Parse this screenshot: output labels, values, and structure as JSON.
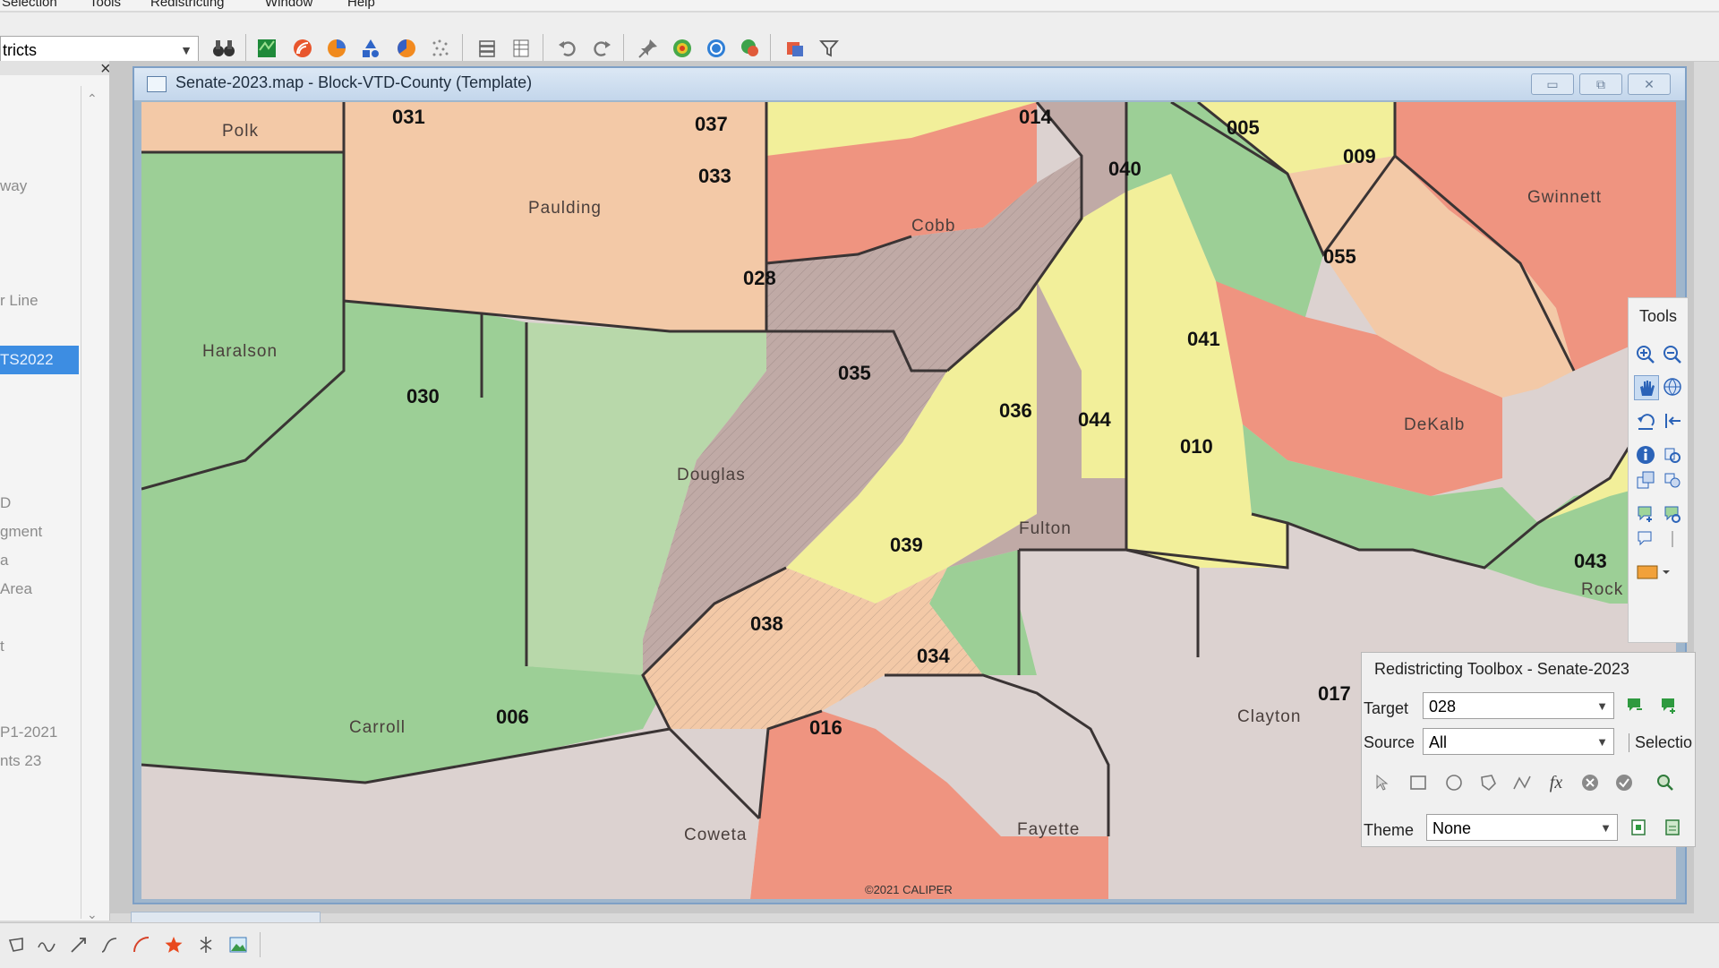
{
  "menu": {
    "items": [
      "Selection",
      "Tools",
      "Redistricting",
      "Window",
      "Help"
    ]
  },
  "toolbar": {
    "layer_select": "tricts",
    "icons": [
      "binoculars-icon",
      "map-layer-icon",
      "rss-layer-icon",
      "pie-chart-icon",
      "shapes-icon",
      "color-theme-icon",
      "dot-density-icon",
      "stack-icon",
      "table-icon",
      "undo-icon",
      "redo-icon",
      "pin-icon",
      "target-icon",
      "circle-icon",
      "map-search-icon",
      "map-overlay-icon",
      "filter-icon"
    ]
  },
  "left_panel": {
    "items": [
      "way",
      "r Line",
      "TS2022",
      "D",
      "gment",
      "a",
      " Area",
      "t",
      "P1-2021",
      "nts 23"
    ],
    "selected_index": 2
  },
  "map_window": {
    "title": "Senate-2023.map - Block-VTD-County (Template)",
    "buttons": [
      "▭",
      "⧉",
      "✕"
    ]
  },
  "map": {
    "district_labels": [
      "031",
      "037",
      "014",
      "005",
      "009",
      "033",
      "040",
      "028",
      "055",
      "041",
      "035",
      "036",
      "044",
      "010",
      "030",
      "039",
      "043",
      "038",
      "034",
      "006",
      "016",
      "017"
    ],
    "county_labels": [
      "Polk",
      "Paulding",
      "Cobb",
      "Gwinnett",
      "Haralson",
      "DeKalb",
      "Douglas",
      "Fulton",
      "Carroll",
      "Clayton",
      "Coweta",
      "Fayette",
      "Rock"
    ],
    "copyright": "©2021 CALIPER",
    "colors": {
      "peach": "#f3c9a7",
      "green": "#9ccf96",
      "light_green": "#b8d8aa",
      "yellow": "#f2ef9a",
      "salmon": "#ef9480",
      "mauve": "#c0aaa6",
      "light_gray": "#dcd2d0",
      "boundary": "#3a3434"
    }
  },
  "tools_panel": {
    "title": "Tools",
    "icons": [
      "zoom-in-icon",
      "zoom-out-icon",
      "pan-hand-icon",
      "globe-icon",
      "back-icon",
      "extent-icon",
      "info-icon",
      "label-icon",
      "layers-icon",
      "link-icon",
      "select-add-icon",
      "select-point-icon",
      "select-box-icon",
      "divider-icon",
      "palette-icon"
    ]
  },
  "toolbox": {
    "title": "Redistricting Toolbox - Senate-2023",
    "target_label": "Target",
    "target_value": "028",
    "source_label": "Source",
    "source_value": "All",
    "selection_label": "Selectio",
    "theme_label": "Theme",
    "theme_value": "None"
  },
  "statusbar": {
    "icons": [
      "lasso-icon",
      "freehand-icon",
      "arrow-icon",
      "curve-icon",
      "arc-icon",
      "star-icon",
      "split-icon",
      "image-icon"
    ]
  }
}
